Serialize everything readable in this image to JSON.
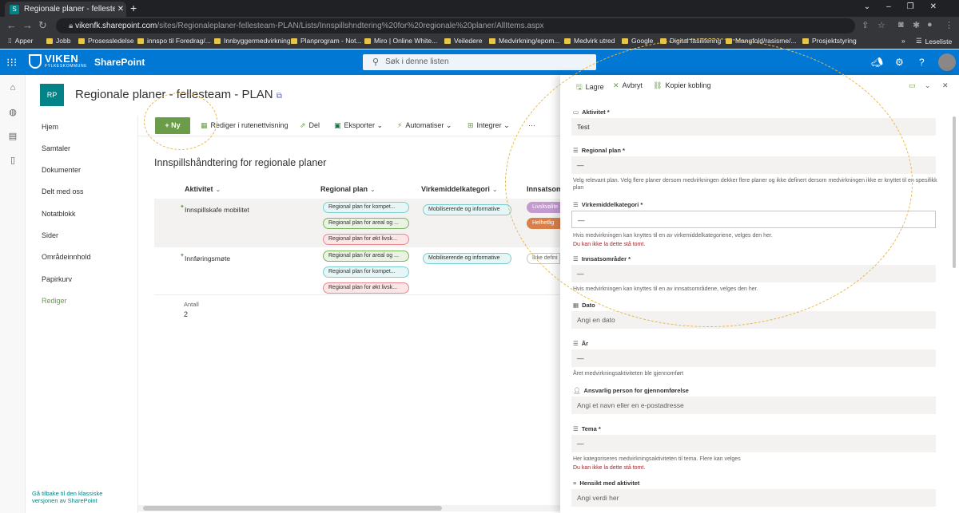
{
  "browser": {
    "tab_title": "Regionale planer - fellesteam - PLAN",
    "new_tab": "+",
    "url_host": "vikenfk.sharepoint.com",
    "url_path": "/sites/Regionaleplaner-fellesteam-PLAN/Lists/Innspillshndtering%20for%20regionale%20planer/AllItems.aspx",
    "bookmarks": [
      "Apper",
      "Jobb",
      "Prosessledelse",
      "innspo til Foredrag/...",
      "Innbyggermedvirkning",
      "Planprogram - Not...",
      "Miro | Online White...",
      "Veiledere",
      "Medvirkning/epom...",
      "Medvirk utred",
      "Google",
      "Digital fasilitering",
      "Mangfold/rasisme/...",
      "Prosjektstyring"
    ],
    "reading_list": "Leseliste"
  },
  "suite": {
    "brand": "VIKEN",
    "brand_sub": "FYLKESKOMMUNE",
    "app_name": "SharePoint",
    "search_placeholder": "Søk i denne listen"
  },
  "site": {
    "logo_initials": "RP",
    "title": "Regionale planer - fellesteam - PLAN"
  },
  "site_nav": {
    "items": [
      "Hjem",
      "Samtaler",
      "Dokumenter",
      "Delt med oss",
      "Notatblokk",
      "Sider",
      "Områdeinnhold",
      "Papirkurv",
      "Rediger"
    ],
    "classic_link": "Gå tilbake til den klassiske versjonen av SharePoint"
  },
  "commands": {
    "new": "Ny",
    "grid_edit": "Rediger i rutenettvisning",
    "share": "Del",
    "export": "Eksporter",
    "automate": "Automatiser",
    "integrate": "Integrer",
    "more": "···"
  },
  "list": {
    "title": "Innspillshåndtering for regionale planer",
    "columns": [
      "Aktivitet",
      "Regional plan",
      "Virkemiddelkategori",
      "Innsatsområder"
    ],
    "rows": [
      {
        "activity": "Innspillskafe mobilitet",
        "plans": [
          "Regional plan for kompet...",
          "Regional plan for areal og ...",
          "Regional plan for økt livsk..."
        ],
        "category": "Mobiliserende og informative",
        "areas": [
          "Livskvalite",
          "Helhetlig"
        ]
      },
      {
        "activity": "Innføringsmøte",
        "plans": [
          "Regional plan for areal og ...",
          "Regional plan for kompet...",
          "Regional plan for økt livsk..."
        ],
        "category": "Mobiliserende og informative",
        "areas": [
          "Ikke defini"
        ]
      }
    ],
    "count_label": "Antall",
    "count_value": "2"
  },
  "panel": {
    "save": "Lagre",
    "cancel": "Avbryt",
    "copy_link": "Kopier kobling",
    "fields": {
      "aktivitet": {
        "label": "Aktivitet *",
        "value": "Test"
      },
      "regional_plan": {
        "label": "Regional plan *",
        "value": "—",
        "help": "Velg relevant plan. Velg flere planer dersom medvirkningen dekker flere planer og ikke definert dersom medvirkningen ikke er knyttet til en spesifikk plan"
      },
      "virkemiddel": {
        "label": "Virkemiddelkategori *",
        "value": "—",
        "help": "Hvis medvirkningen kan knyttes til en av virkemiddelkategoriene, velges den her.",
        "error": "Du kan ikke la dette stå tomt."
      },
      "innsats": {
        "label": "Innsatsområder *",
        "value": "—",
        "help": "Hvis medvirkningen kan knyttes til en av innsatsområdene, velges den her."
      },
      "dato": {
        "label": "Dato",
        "placeholder": "Angi en dato"
      },
      "aar": {
        "label": "År",
        "value": "—",
        "help": "Året medvirkningsaktiviteten ble gjennomført"
      },
      "ansvarlig": {
        "label": "Ansvarlig person for gjennomførelse",
        "placeholder": "Angi et navn eller en e-postadresse"
      },
      "tema": {
        "label": "Tema *",
        "value": "—",
        "help": "Her kategoriseres medvirkningsaktiviteten til tema. Flere kan velges",
        "error": "Du kan ikke la dette stå tomt."
      },
      "hensikt": {
        "label": "Hensikt med aktivitet",
        "placeholder": "Angi verdi her"
      }
    }
  },
  "colors": {
    "suite_blue": "#0078d4",
    "accent_green": "#6a9c4a",
    "site_teal": "#038387",
    "error_red": "#a4262c",
    "annotation": "#e6b84a"
  }
}
